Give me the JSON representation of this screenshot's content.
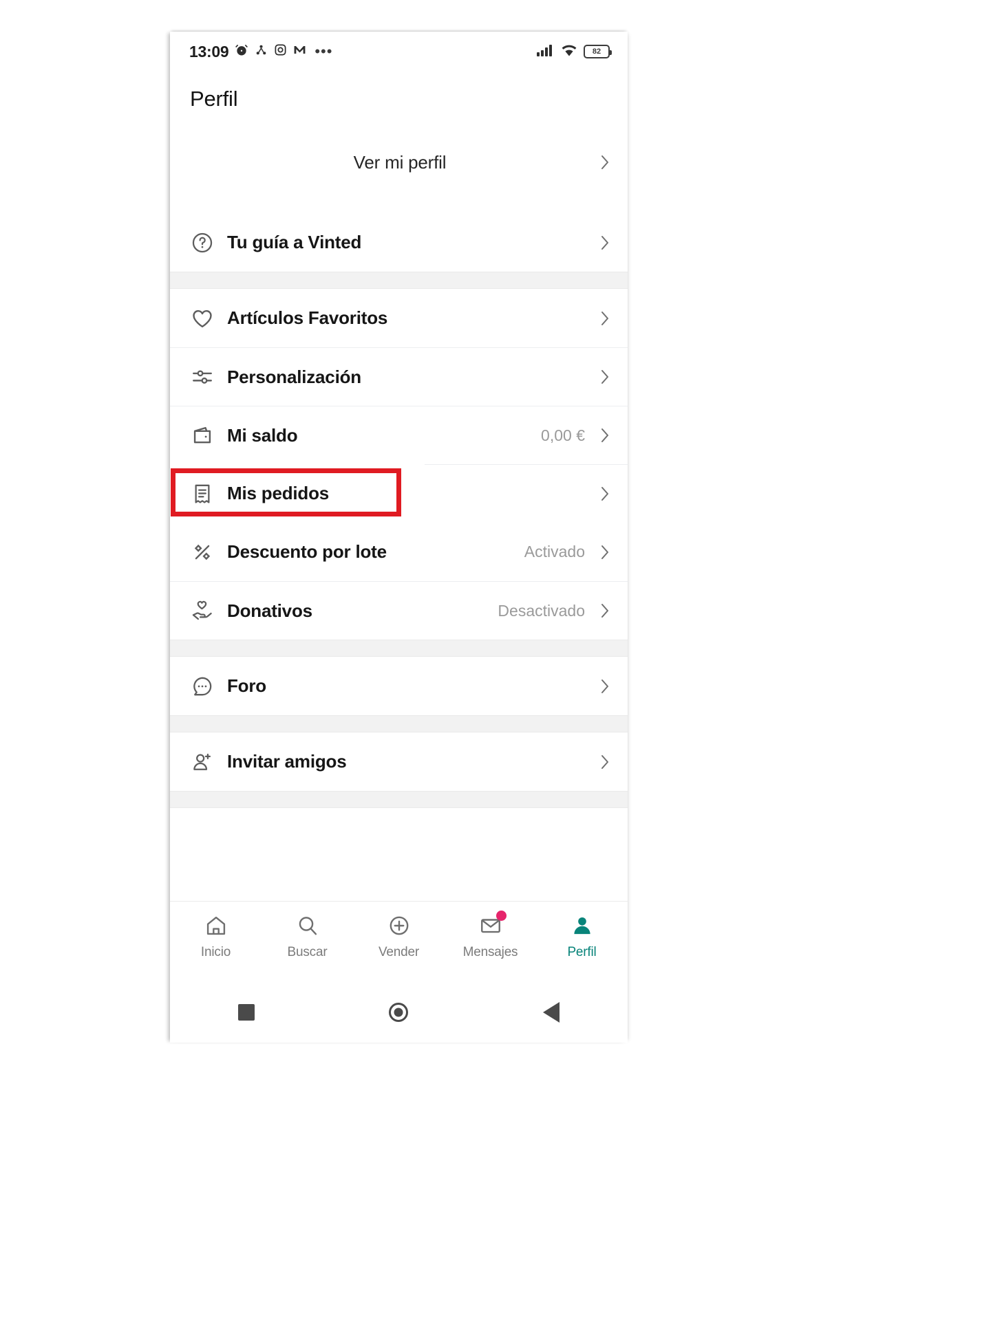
{
  "status_bar": {
    "time": "13:09",
    "battery_level": "82",
    "left_icons": [
      "alarm-icon",
      "bluetooth-share-icon",
      "instagram-icon",
      "gmail-icon",
      "more-dots-icon"
    ],
    "right_icons": [
      "cellular-signal-icon",
      "wifi-icon",
      "battery-icon"
    ]
  },
  "header": {
    "title": "Perfil"
  },
  "sections": [
    {
      "rows": [
        {
          "label": "Ver mi perfil",
          "icon": "",
          "value": "",
          "type": "profile"
        }
      ]
    },
    {
      "rows": [
        {
          "label": "Tu guía a Vinted",
          "icon": "question-circle-icon",
          "value": "",
          "type": "item"
        }
      ]
    },
    {
      "rows": [
        {
          "label": "Artículos Favoritos",
          "icon": "heart-icon",
          "value": "",
          "type": "item"
        },
        {
          "label": "Personalización",
          "icon": "sliders-icon",
          "value": "",
          "type": "item"
        },
        {
          "label": "Mi saldo",
          "icon": "wallet-icon",
          "value": "0,00 €",
          "type": "item"
        },
        {
          "label": "Mis pedidos",
          "icon": "receipt-icon",
          "value": "",
          "type": "item",
          "highlighted": true
        },
        {
          "label": "Descuento por lote",
          "icon": "percent-icon",
          "value": "Activado",
          "type": "item"
        },
        {
          "label": "Donativos",
          "icon": "hand-heart-icon",
          "value": "Desactivado",
          "type": "item"
        }
      ]
    },
    {
      "rows": [
        {
          "label": "Foro",
          "icon": "chat-bubble-icon",
          "value": "",
          "type": "item"
        }
      ]
    },
    {
      "rows": [
        {
          "label": "Invitar amigos",
          "icon": "user-plus-icon",
          "value": "",
          "type": "item"
        }
      ]
    }
  ],
  "tab_bar": {
    "items": [
      {
        "label": "Inicio",
        "icon": "home-icon",
        "active": false,
        "badge": false
      },
      {
        "label": "Buscar",
        "icon": "search-icon",
        "active": false,
        "badge": false
      },
      {
        "label": "Vender",
        "icon": "plus-circle-icon",
        "active": false,
        "badge": false
      },
      {
        "label": "Mensajes",
        "icon": "envelope-icon",
        "active": false,
        "badge": true
      },
      {
        "label": "Perfil",
        "icon": "person-icon",
        "active": true,
        "badge": false
      }
    ]
  },
  "android_nav": {
    "buttons": [
      "recents-square-icon",
      "home-circle-icon",
      "back-triangle-icon"
    ]
  },
  "colors": {
    "highlight_red": "#e01b22",
    "accent_teal": "#09847a",
    "badge_pink": "#e6246b",
    "section_gap": "#f2f2f2"
  }
}
